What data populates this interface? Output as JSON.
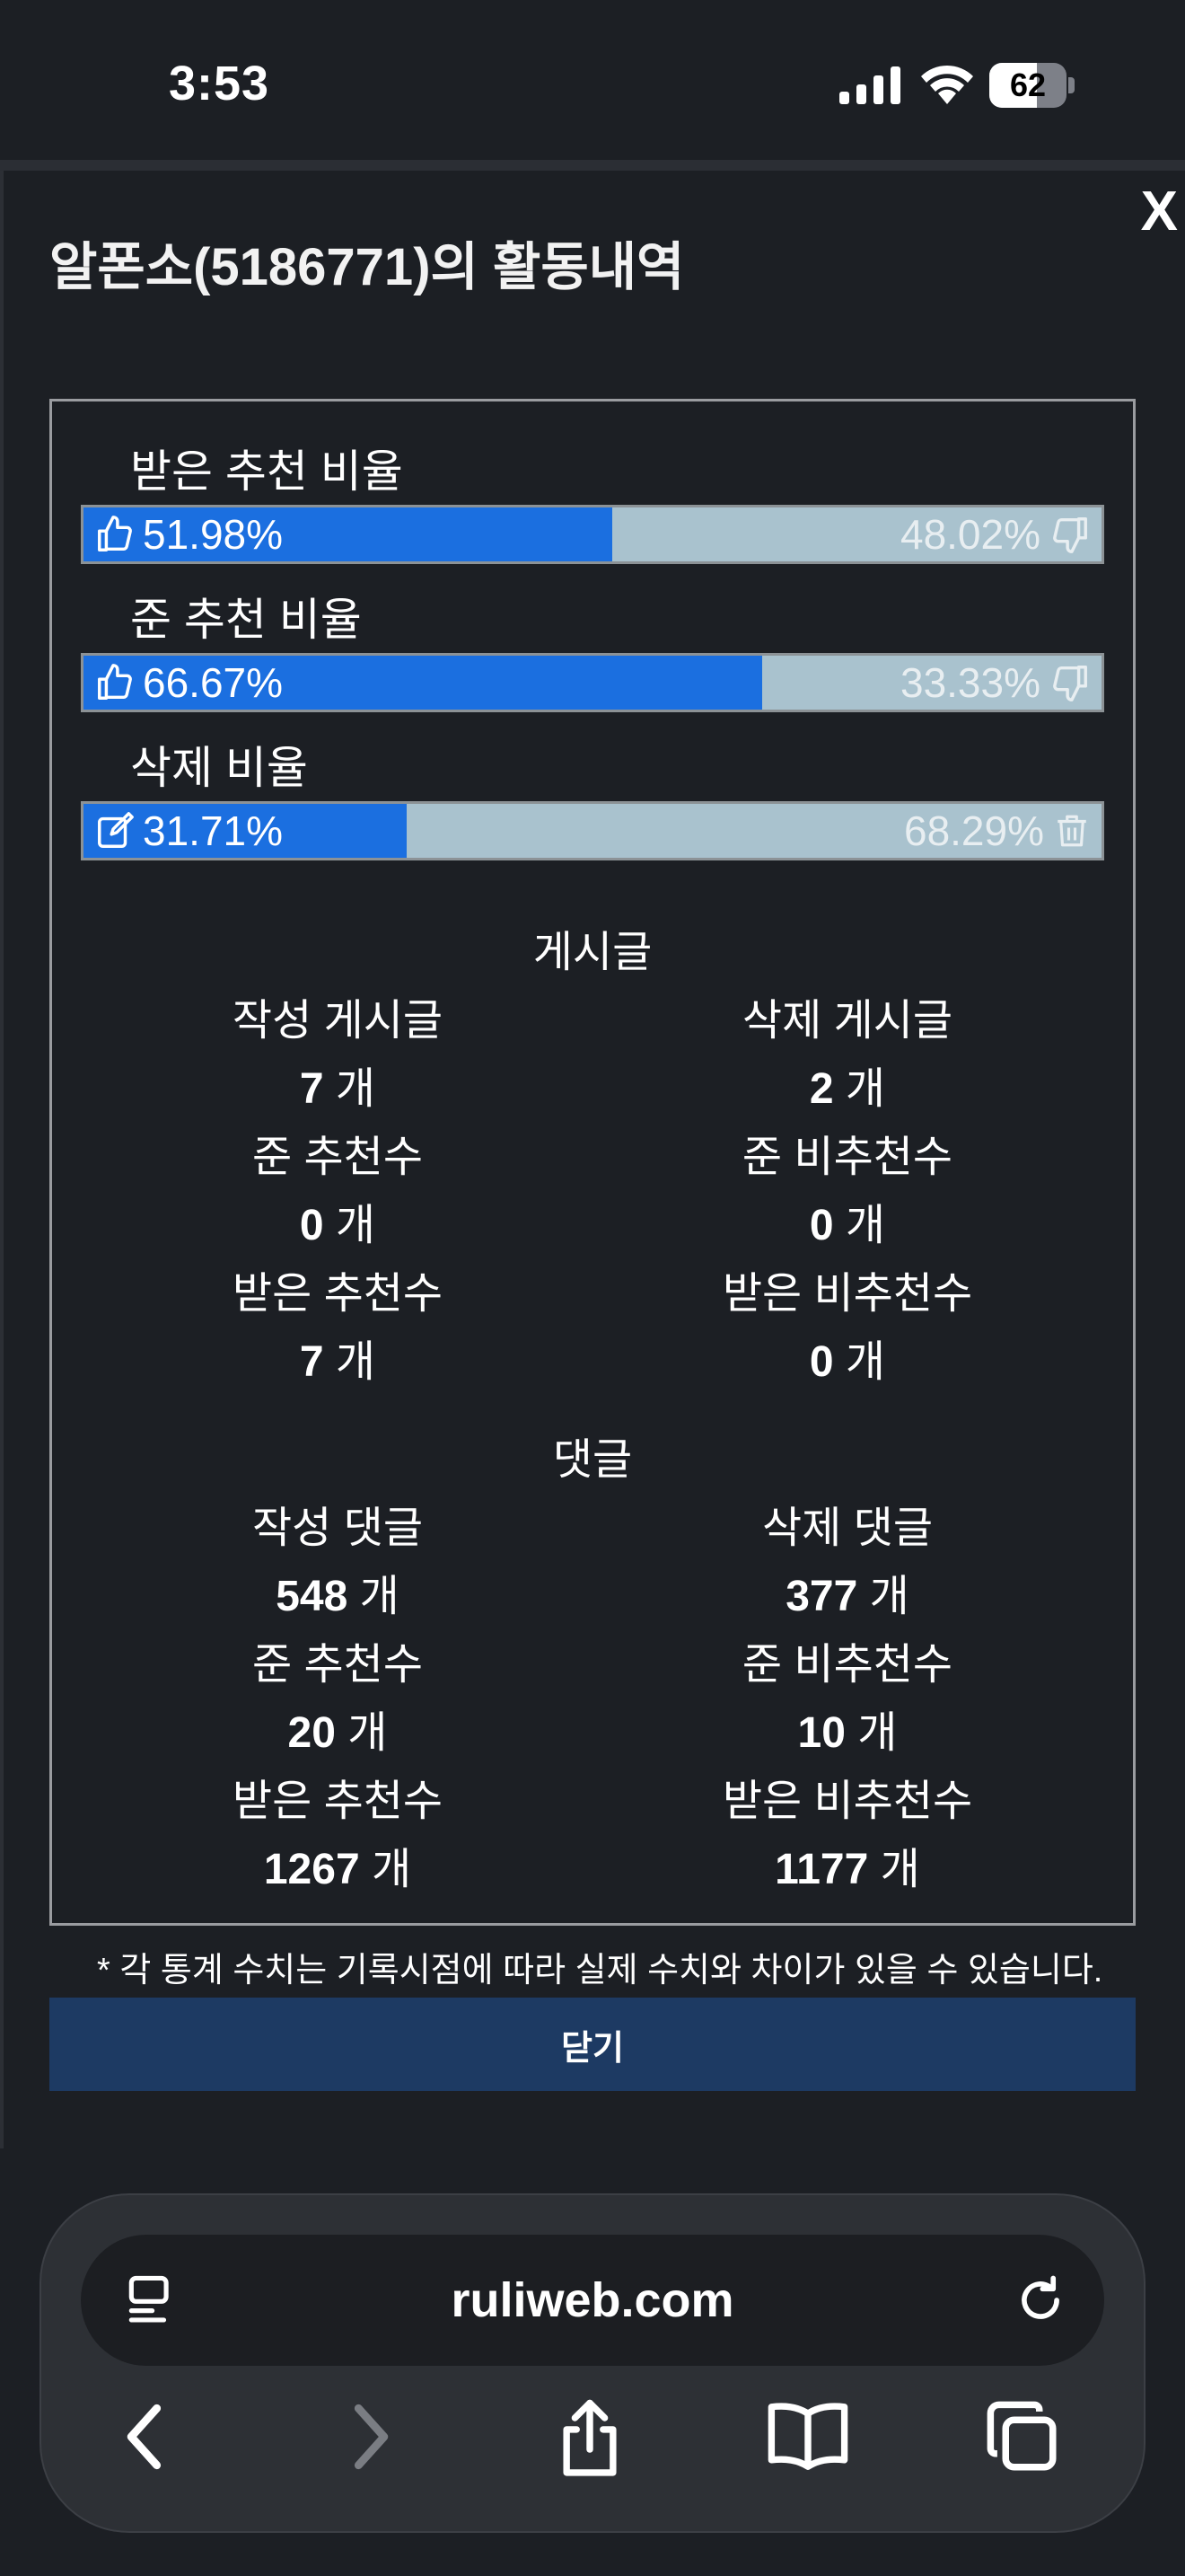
{
  "status_bar": {
    "time": "3:53",
    "battery": "62",
    "battery_level": 0.62
  },
  "modal": {
    "title": "알폰소(5186771)의 활동내역",
    "close_x": "X",
    "ratios": [
      {
        "label": "받은 추천 비율",
        "left_value": "51.98%",
        "right_value": "48.02%",
        "fill": 51.98,
        "left_icon": "thumbs-up-icon",
        "right_icon": "thumbs-down-icon"
      },
      {
        "label": "준 추천 비율",
        "left_value": "66.67%",
        "right_value": "33.33%",
        "fill": 66.67,
        "left_icon": "thumbs-up-icon",
        "right_icon": "thumbs-down-icon"
      },
      {
        "label": "삭제 비율",
        "left_value": "31.71%",
        "right_value": "68.29%",
        "fill": 31.71,
        "left_icon": "edit-icon",
        "right_icon": "trash-icon"
      }
    ],
    "posts": {
      "title": "게시글",
      "written_label": "작성 게시글",
      "written_value": "7",
      "written_unit": " 개",
      "deleted_label": "삭제 게시글",
      "deleted_value": "2",
      "deleted_unit": " 개",
      "given_up_label": "준 추천수",
      "given_up_value": "0",
      "given_up_unit": " 개",
      "given_down_label": "준 비추천수",
      "given_down_value": "0",
      "given_down_unit": " 개",
      "received_up_label": "받은 추천수",
      "received_up_value": "7",
      "received_up_unit": " 개",
      "received_down_label": "받은 비추천수",
      "received_down_value": "0",
      "received_down_unit": " 개"
    },
    "comments": {
      "title": "댓글",
      "written_label": "작성 댓글",
      "written_value": "548",
      "written_unit": " 개",
      "deleted_label": "삭제 댓글",
      "deleted_value": "377",
      "deleted_unit": " 개",
      "given_up_label": "준 추천수",
      "given_up_value": "20",
      "given_up_unit": " 개",
      "given_down_label": "준 비추천수",
      "given_down_value": "10",
      "given_down_unit": " 개",
      "received_up_label": "받은 추천수",
      "received_up_value": "1267",
      "received_up_unit": " 개",
      "received_down_label": "받은 비추천수",
      "received_down_value": "1177",
      "received_down_unit": " 개"
    },
    "disclaimer": "* 각 통계 수치는 기록시점에 따라 실제 수치와 차이가 있을 수 있습니다.",
    "close_button": "닫기"
  },
  "browser": {
    "url": "ruliweb.com"
  },
  "colors": {
    "background": "#1c1f24",
    "bar_fill": "#1b6fe0",
    "bar_track": "#a9c2ce",
    "close_button": "#1d3a63"
  }
}
